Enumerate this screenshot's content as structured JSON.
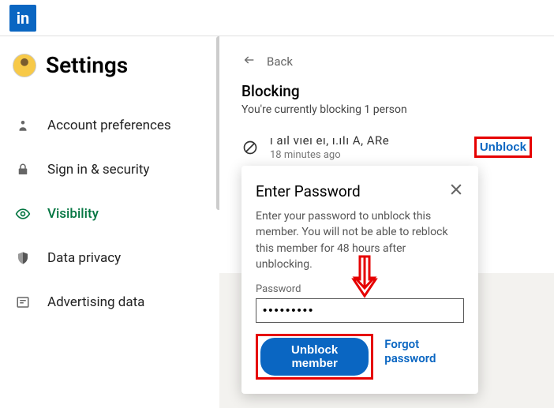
{
  "topbar": {
    "logo_text": "in"
  },
  "sidebar": {
    "settings_title": "Settings",
    "items": [
      {
        "label": "Account preferences"
      },
      {
        "label": "Sign in & security"
      },
      {
        "label": "Visibility"
      },
      {
        "label": "Data privacy"
      },
      {
        "label": "Advertising data"
      }
    ]
  },
  "content": {
    "back_label": "Back",
    "title": "Blocking",
    "subtitle": "You're currently blocking 1 person",
    "blocked_name": "ı aıl vıeı eı, ı.ıIı A, ARe",
    "blocked_time": "18 minutes ago",
    "unblock_label": "Unblock"
  },
  "modal": {
    "title": "Enter Password",
    "body": "Enter your password to unblock this member. You will not be able to reblock this member for 48 hours after unblocking.",
    "field_label": "Password",
    "password_value": "•••••••••",
    "unblock_member_label": "Unblock member",
    "forgot_label": "Forgot password"
  }
}
